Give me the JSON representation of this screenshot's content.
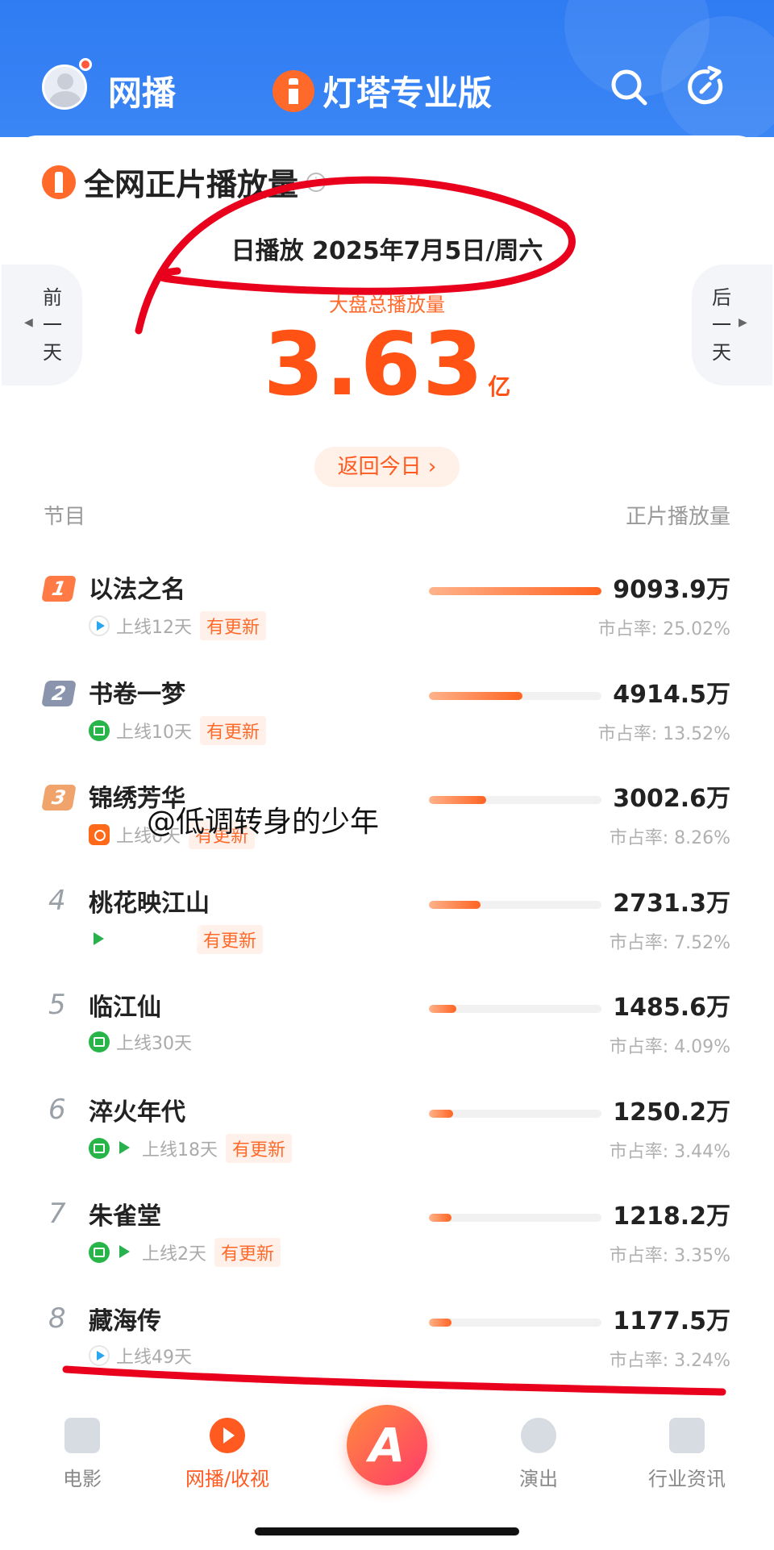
{
  "header": {
    "tab_label": "网播",
    "brand_name": "灯塔专业版",
    "icons": [
      "avatar",
      "search-icon",
      "refresh-icon"
    ]
  },
  "section": {
    "title": "全网正片播放量",
    "date_line": "日播放 2025年7月5日/周六",
    "prev_label": "前一天",
    "next_label": "后一天",
    "total_label": "大盘总播放量",
    "total_value": "3.63",
    "total_unit": "亿",
    "back_today": "返回今日 ›",
    "col_left": "节目",
    "col_right": "正片播放量"
  },
  "rows": [
    {
      "rank": "1",
      "title": "以法之名",
      "online": "上线12天",
      "update": "有更新",
      "value": "9093.9万",
      "share": "市占率: 25.02%",
      "bar": 1.0,
      "platforms": [
        "tencent"
      ]
    },
    {
      "rank": "2",
      "title": "书卷一梦",
      "online": "上线10天",
      "update": "有更新",
      "value": "4914.5万",
      "share": "市占率: 13.52%",
      "bar": 0.54,
      "platforms": [
        "iqiyi"
      ]
    },
    {
      "rank": "3",
      "title": "锦绣芳华",
      "online": "上线6天",
      "update": "有更新",
      "value": "3002.6万",
      "share": "市占率: 8.26%",
      "bar": 0.33,
      "platforms": [
        "mgtv"
      ]
    },
    {
      "rank": "4",
      "title": "桃花映江山",
      "online": "",
      "update": "有更新",
      "value": "2731.3万",
      "share": "市占率: 7.52%",
      "bar": 0.3,
      "platforms": [
        "youku"
      ]
    },
    {
      "rank": "5",
      "title": "临江仙",
      "online": "上线30天",
      "update": "",
      "value": "1485.6万",
      "share": "市占率: 4.09%",
      "bar": 0.16,
      "platforms": [
        "iqiyi"
      ]
    },
    {
      "rank": "6",
      "title": "淬火年代",
      "online": "上线18天",
      "update": "有更新",
      "value": "1250.2万",
      "share": "市占率: 3.44%",
      "bar": 0.14,
      "platforms": [
        "iqiyi",
        "youku"
      ]
    },
    {
      "rank": "7",
      "title": "朱雀堂",
      "online": "上线2天",
      "update": "有更新",
      "value": "1218.2万",
      "share": "市占率: 3.35%",
      "bar": 0.13,
      "platforms": [
        "iqiyi",
        "youku"
      ]
    },
    {
      "rank": "8",
      "title": "藏海传",
      "online": "上线49天",
      "update": "",
      "value": "1177.5万",
      "share": "市占率: 3.24%",
      "bar": 0.13,
      "platforms": [
        "tencent"
      ]
    }
  ],
  "watermark": "@低调转身的少年",
  "bottom_nav": {
    "items": [
      {
        "label": "电影"
      },
      {
        "label": "网播/收视"
      },
      {
        "label": ""
      },
      {
        "label": "演出"
      },
      {
        "label": "行业资讯"
      }
    ],
    "center_logo": "A"
  },
  "colors": {
    "accent": "#ff5a1f",
    "header_blue": "#2f7bf2",
    "rank1": "#ff7a45",
    "rank2": "#8a95ad",
    "rank3": "#f0a36a",
    "annotation_red": "#e8001c"
  }
}
